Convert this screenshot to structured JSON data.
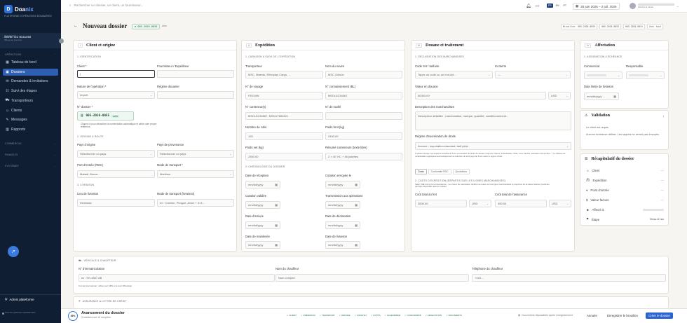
{
  "brand": {
    "name_a": "Doa",
    "name_b": "nix",
    "tagline": "Plateforme d'opérations douanières"
  },
  "sidebar": {
    "org_label": "Organisation",
    "org_name": "Seven Go Success",
    "org_sub": "Mbeya se Success",
    "sections": {
      "operations": "OPÉRATIONS",
      "commercial": "COMMERCIAL",
      "finances": "FINANCES",
      "systems": "SYSTÈMES"
    },
    "items": [
      {
        "label": "Tableau de bord",
        "icon": "grid-icon"
      },
      {
        "label": "Dossiers",
        "icon": "folder-icon",
        "active": true
      },
      {
        "label": "Demandes & invitations",
        "icon": "inbox-icon"
      },
      {
        "label": "Suivi des étapes",
        "icon": "steps-icon"
      },
      {
        "label": "Transporteurs",
        "icon": "truck-icon"
      },
      {
        "label": "Clients",
        "icon": "users-icon"
      },
      {
        "label": "Messages",
        "icon": "chat-icon"
      },
      {
        "label": "Rapports",
        "icon": "chart-icon"
      }
    ],
    "admin": "Admin plateforme",
    "systems_note": "Tous les systèmes opérationnels"
  },
  "topbar": {
    "search_placeholder": "Rechercher un dossier, un client, un fournisseur...",
    "langs": [
      "FR",
      "EN",
      "PT"
    ],
    "date_range": "26 juin 2026 – 2 juil. 2026",
    "user_role": "Admin de la société"
  },
  "page": {
    "title": "Nouveau dossier",
    "dossier_no": "⊕ 005-2026-0055",
    "state": "Auto",
    "top_buttons": [
      "Brouillon: 005-2026-0055",
      "005-2026-0055",
      "005-2026-0051",
      "Voir tout"
    ]
  },
  "card1": {
    "num": "I",
    "title": "Client et origine",
    "s1": "1. IDENTIFICATION",
    "client": "Client *",
    "supplier": "Fournisseur / Expéditeur",
    "operation": "Nature de l'opération *",
    "operation_val": "Import",
    "regime": "Régime douanier",
    "dossier_label": "N° dossier *",
    "dossier_val": "005-2026-0055",
    "auto": "AUTO",
    "dossier_note": "Cliquez ici pour désactiver la numérotation automatique et saisir votre propre référence.",
    "s2": "2. ORIGINE & ROUTE",
    "origin": "Pays d'origine",
    "origin_ph": "Sélectionner un pays",
    "prov": "Pays de provenance",
    "prov_ph": "Sélectionner un pays",
    "port": "Port d'entrée (RDC)",
    "port_ph": "Matadi, Boma...",
    "mode": "Mode de transport *",
    "mode_val": "Maritime",
    "s3": "3. LIVRAISON",
    "place": "Lieu de livraison",
    "place_val": "Kinshasa",
    "mode_liv": "Mode de transport (livraison)",
    "mode_liv_ph": "ex : Camion, Pirogue, Avion + 4×4..."
  },
  "card2": {
    "num": "II",
    "title": "Expédition",
    "s1": "1. CARAISON & SUIVI DE L'EXPÉDITION",
    "carrier": "Transporteur",
    "carrier_ph": "MSC, Maersk, Ethiopian Cargo, ...",
    "ship": "Nom du navire",
    "ship_ph": "MSC Gülsün",
    "voyage": "N° de voyage",
    "voyage_ph": "FE019W",
    "bl": "N° connaissement (BL)",
    "bl_ph": "MEDU1234567",
    "cont": "N° conteneur(s)",
    "cont_ph": "MSCU1234567, MSCU7654321",
    "seal": "N° de scellé",
    "pkgs": "Nombre de colis",
    "pkgs_ph": "120",
    "gross": "Poids brut (kg)",
    "gross_ph": "2400.00",
    "net": "Poids net (kg)",
    "net_ph": "2300.00",
    "pkg_sum": "Résumé conteneurs (texte libre)",
    "pkg_sum_ph": "2 × 40' HC + 46 palettes",
    "s2": "2. CHRONOLOGIE DU DOSSIER",
    "date_ph": "mm/dd/yyyy",
    "d1": "Date de réception",
    "d2": "Cotation envoyée le",
    "d3": "Cotation validée",
    "d4": "Transmission aux opérations",
    "d5": "Date d'arrivée",
    "d6": "Date de déclaration",
    "d7": "Date de mainlevée",
    "d8": "Date de livraison"
  },
  "card3": {
    "num": "III",
    "title": "Douane et traitement",
    "s1": "1. DÉCLARATION DES MARCHANDISES",
    "hs": "Code SH / tarifaire",
    "hs_ph": "Tapez un code ou un mot-clé...",
    "inco": "Incoterm",
    "inco_ph": "—",
    "customs_value": "Valeur en douane",
    "customs_value_ph": "50000.00",
    "cur": "USD",
    "desc": "Description des marchandises",
    "desc_ph": "Description détaillée : marchandise, marque, quantité, conditionnement...",
    "regime_ex": "Régime d'exonération de droits",
    "regime_ex_val": "Aucune : importation standard, tarif plein",
    "regime_note": "À utiliser lorsque vos dossiers bénéficient d'une exonération de droits de douane (régimes miniers, ambassades, ONG, zone franche, admission temporaire...). Le tableau de récapitulation appliquera automatiquement la réduction du droit payé de 5 ans selon le régime choisi.",
    "tabs": [
      "Costs",
      "Conformité RDC",
      "Quotations"
    ],
    "s2": "2. COÛTS D'EXPÉDITION (RÉPARTIS SUR LES LIGNES MARCHANDISES)",
    "s2_note": "Saisir UNE fois le fret et l'assurance... Le moteur de valorisation répartit ces totaux sur les lignes marchandises à proportion de la valeur facturée (méthode par ligne disponible dans le module).",
    "freight": "Coût total du fret",
    "freight_ph": "3500.00",
    "ins": "Coût total de l'assurance",
    "ins_ph": "450.00"
  },
  "card4": {
    "num": "IV",
    "title": "Affectation",
    "s1": "1. ASSIGNATION & ÉCHÉANCE",
    "commercial": "Commercial",
    "resp": "Responsable",
    "deadline": "Date limite de livraison",
    "date_ph": "mm/dd/yyyy",
    "validation": "Validation",
    "val1": "Le client est requis.",
    "val2": "Aucune échéance définie. Les rappels ne seront pas envoyés.",
    "recap": "Récapitulatif du dossier",
    "recap_rows": [
      {
        "label": "Client",
        "kind": "r"
      },
      {
        "label": "Expédition",
        "kind": "r"
      },
      {
        "label": "Point d'entrée",
        "kind": "r"
      },
      {
        "label": "Valeur facture",
        "kind": "r"
      },
      {
        "label": "Affecté à",
        "kind": "blur"
      },
      {
        "label": "Étape",
        "kind": "badge",
        "value": "Brouillon"
      }
    ]
  },
  "vehicle": {
    "title": "VÉHICULE & CHAUFFEUR",
    "plate": "N° d'immatriculation",
    "plate_ph": "ex : KN 4567 AB",
    "driver": "Nom du chauffeur",
    "driver_ph": "Nom complet",
    "phone": "Téléphone du chauffeur",
    "phone_ph": "+243 ...",
    "plate_note": "Format international : utilisé pour SMS et le suivi WhatsApp.",
    "insurance": "ASSURANCE & LETTRE DE CRÉDIT"
  },
  "footer": {
    "pct": "26%",
    "title": "Avancement du dossier",
    "sub": "3 sections sur 10 remplies",
    "steps": [
      "✓ CLIENT",
      "✓ OPÉRATION",
      "✓ TRANSPORT",
      "✓ ORIGINE",
      "✓ CODE SH",
      "✓ COÛTS",
      "✓ CALENDRIER",
      "✓ CONFORMITÉ",
      "✓ AFFECTATION",
      "✓ DOCUMENTS"
    ],
    "autosave": "Documents déposables après enregistrement",
    "cancel": "Annuler",
    "save_draft": "Enregistrer le brouillon",
    "create": "Créer le dossier"
  }
}
